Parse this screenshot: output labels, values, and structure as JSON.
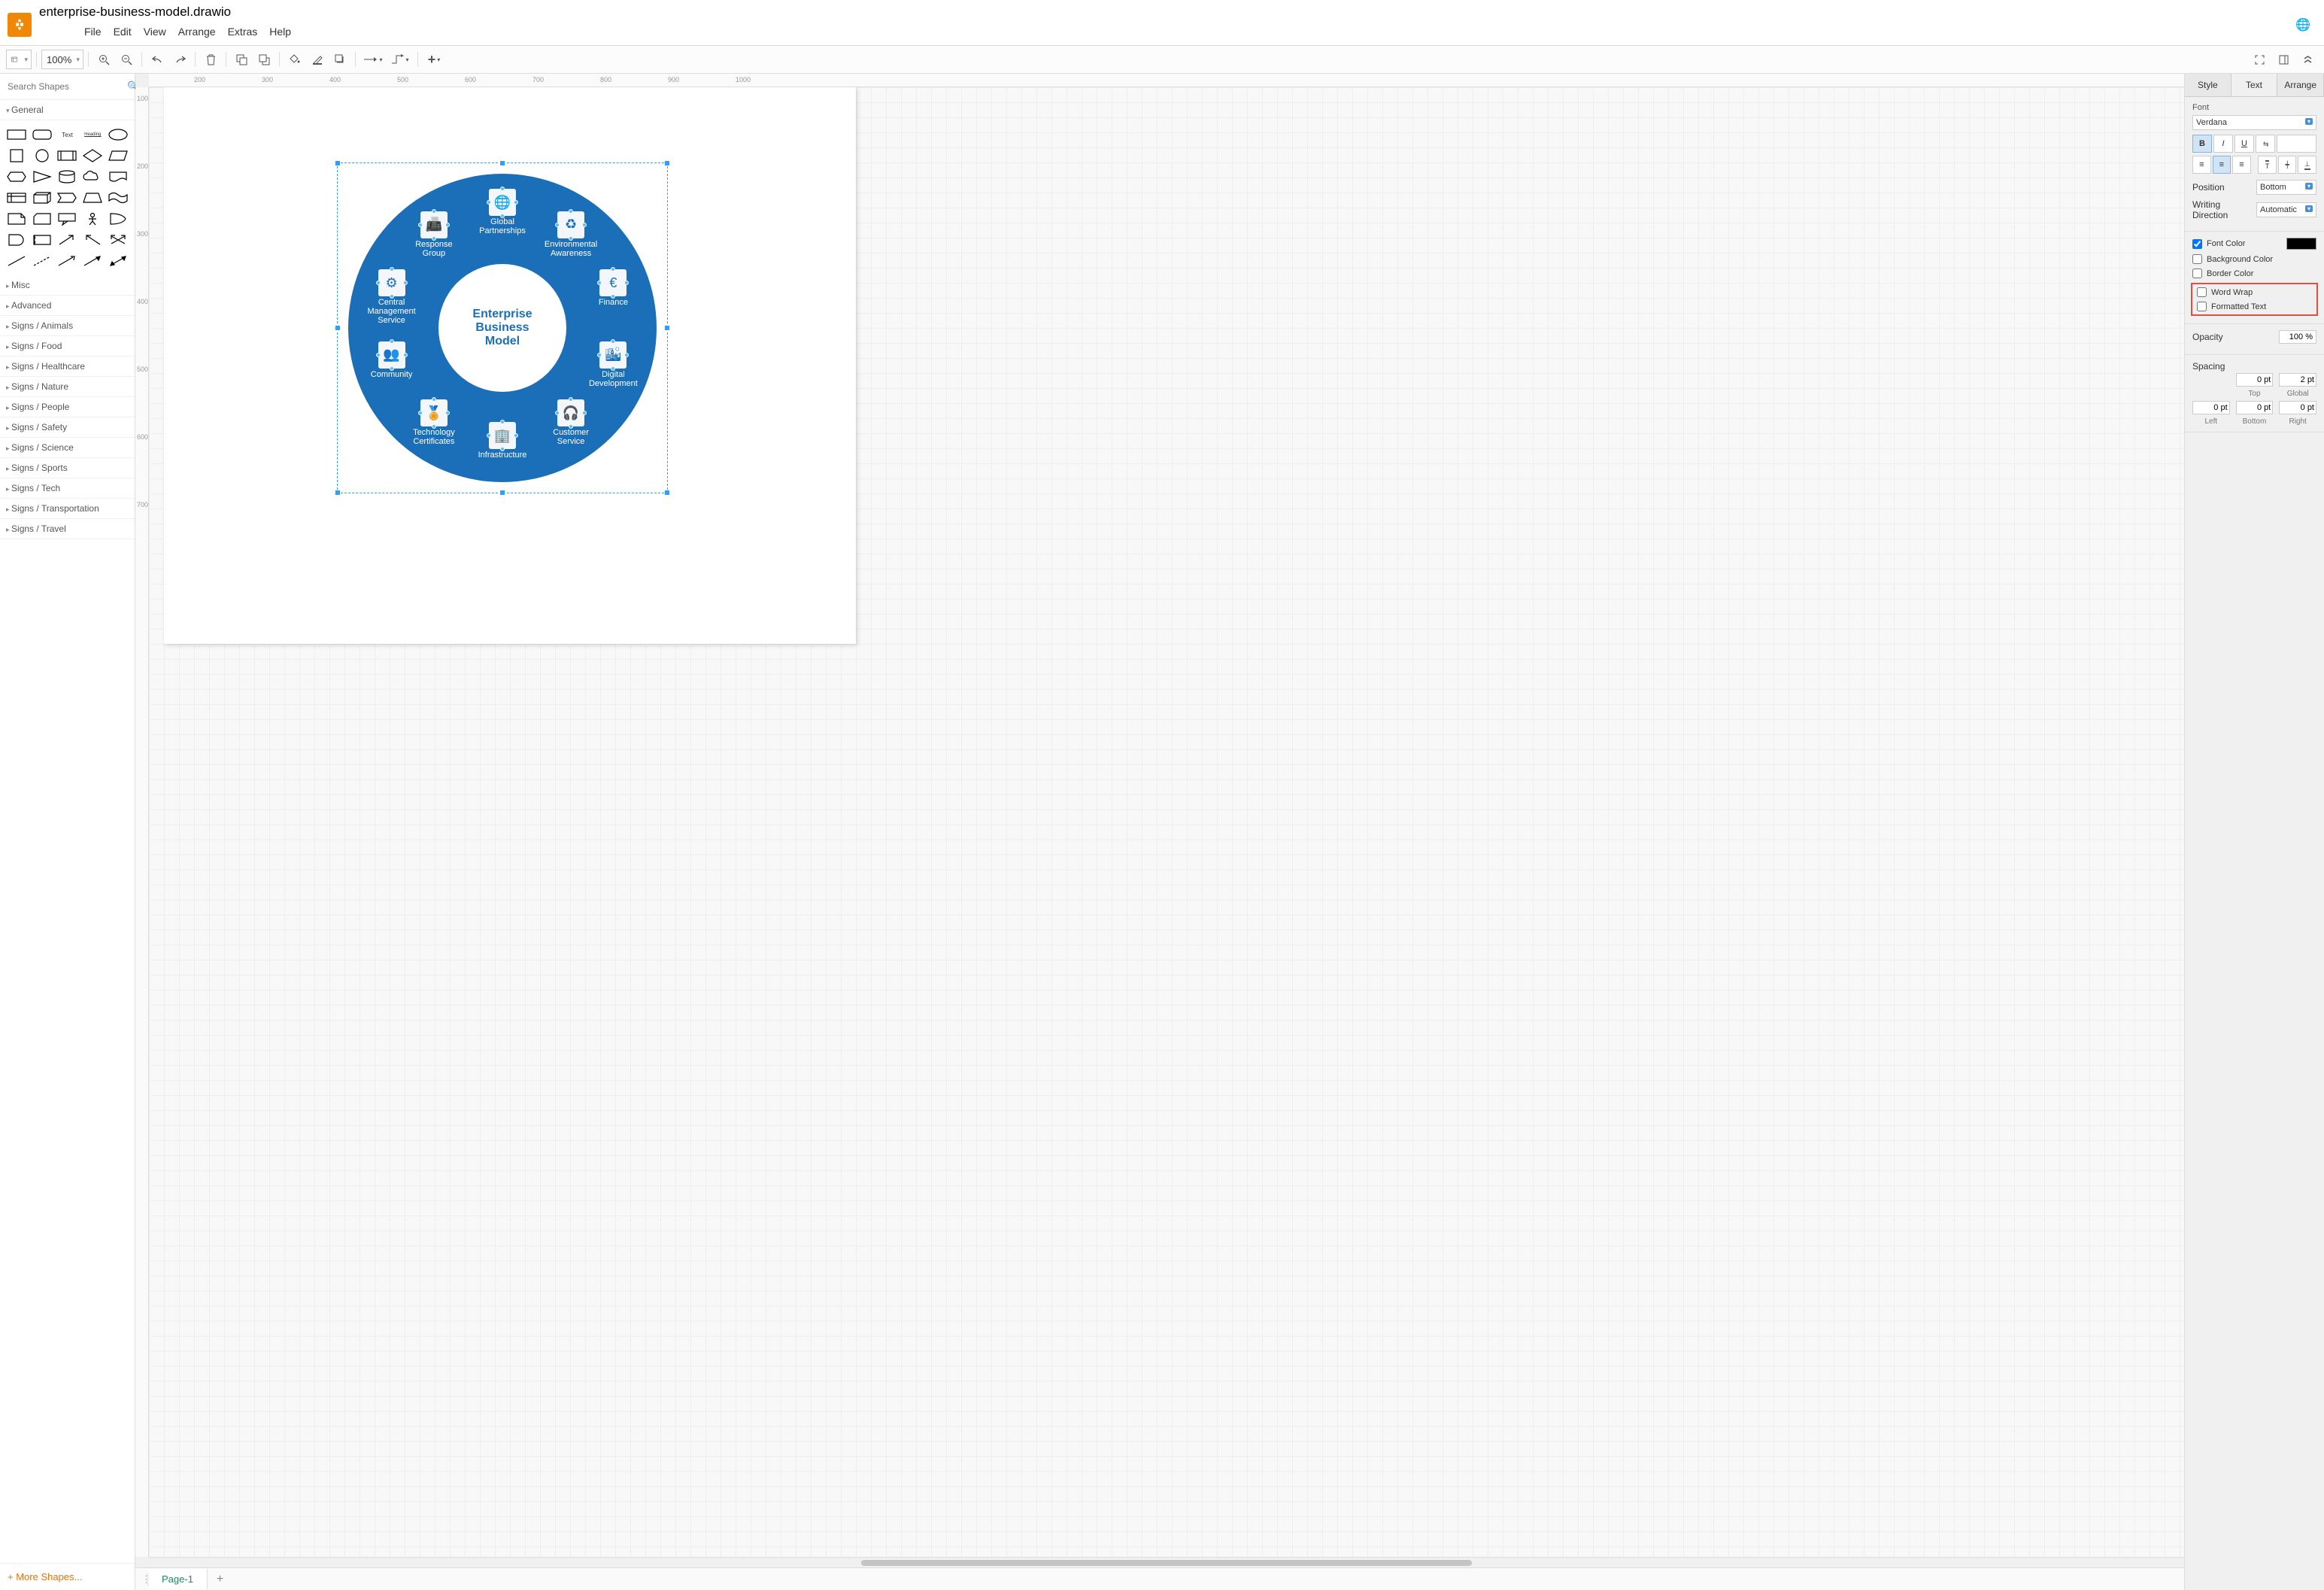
{
  "title": "enterprise-business-model.drawio",
  "menu": [
    "File",
    "Edit",
    "View",
    "Arrange",
    "Extras",
    "Help"
  ],
  "toolbar": {
    "zoom": "100%"
  },
  "search": {
    "placeholder": "Search Shapes"
  },
  "categories": {
    "open": "General",
    "closed": [
      "Misc",
      "Advanced",
      "Signs / Animals",
      "Signs / Food",
      "Signs / Healthcare",
      "Signs / Nature",
      "Signs / People",
      "Signs / Safety",
      "Signs / Science",
      "Signs / Sports",
      "Signs / Tech",
      "Signs / Transportation",
      "Signs / Travel"
    ]
  },
  "more_shapes": "More Shapes...",
  "ruler_h": [
    "200",
    "300",
    "400",
    "500",
    "600",
    "700",
    "800",
    "900",
    "1000"
  ],
  "ruler_v": [
    "100",
    "200",
    "300",
    "400",
    "500",
    "600",
    "700"
  ],
  "diagram": {
    "center": "Enterprise\nBusiness\nModel",
    "nodes": [
      {
        "label": "Global\nPartnerships",
        "icon": "globe-icon"
      },
      {
        "label": "Environmental\nAwareness",
        "icon": "recycle-icon"
      },
      {
        "label": "Finance",
        "icon": "euro-icon"
      },
      {
        "label": "Digital\nDevelopment",
        "icon": "buildings-icon"
      },
      {
        "label": "Customer\nService",
        "icon": "headset-icon"
      },
      {
        "label": "Infrastructure",
        "icon": "building-icon"
      },
      {
        "label": "Technology\nCertificates",
        "icon": "award-icon"
      },
      {
        "label": "Community",
        "icon": "people-icon"
      },
      {
        "label": "Central\nManagement\nService",
        "icon": "gears-icon"
      },
      {
        "label": "Response\nGroup",
        "icon": "fax-icon"
      }
    ]
  },
  "right_panel": {
    "tabs": [
      "Style",
      "Text",
      "Arrange"
    ],
    "active_tab": "Text",
    "font_label": "Font",
    "font_value": "Verdana",
    "position_label": "Position",
    "position_value": "Bottom",
    "direction_label": "Writing Direction",
    "direction_value": "Automatic",
    "font_color_label": "Font Color",
    "bg_color_label": "Background Color",
    "border_color_label": "Border Color",
    "wrap_label": "Word Wrap",
    "formatted_label": "Formatted Text",
    "opacity_label": "Opacity",
    "opacity_value": "100 %",
    "spacing_label": "Spacing",
    "spacing": {
      "top": "0 pt",
      "global": "2 pt",
      "left": "0 pt",
      "bottom": "0 pt",
      "right": "0 pt"
    },
    "spacing_captions": {
      "top": "Top",
      "global": "Global",
      "left": "Left",
      "bottom": "Bottom",
      "right": "Right"
    }
  },
  "page_tab": "Page-1"
}
